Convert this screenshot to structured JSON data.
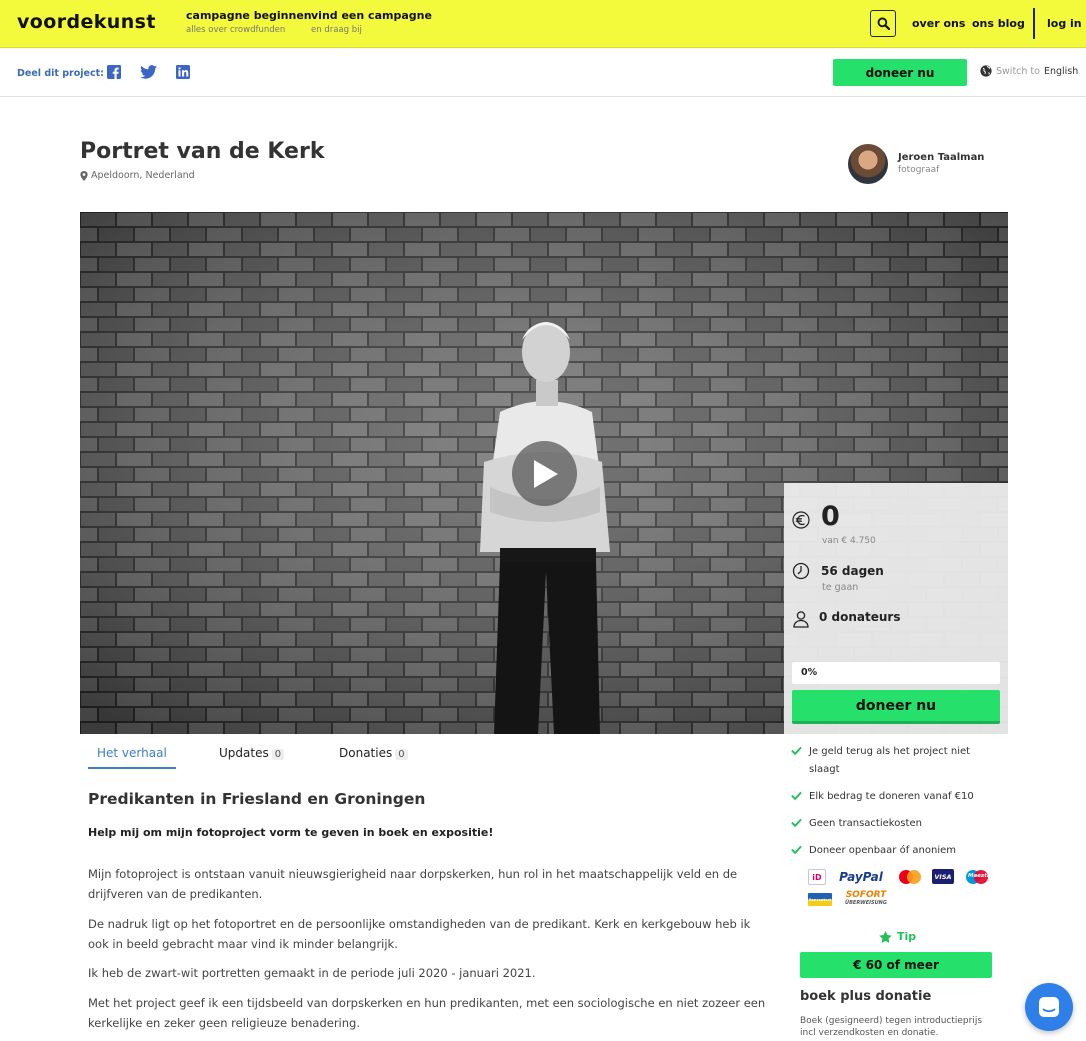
{
  "header": {
    "logo": "voordekunst",
    "nav": [
      {
        "title": "campagne beginnen",
        "sub": "alles over crowdfunden"
      },
      {
        "title": "vind een campagne",
        "sub": "en draag bij"
      }
    ],
    "links": {
      "about": "over ons",
      "blog": "ons blog",
      "login": "log in"
    }
  },
  "sharebar": {
    "label": "Deel dit project:",
    "donate_label": "doneer nu",
    "lang_prefix": "Switch to",
    "lang": "English"
  },
  "project": {
    "title": "Portret van de Kerk",
    "location": "Apeldoorn, Nederland",
    "author_name": "Jeroen Taalman",
    "author_role": "fotograaf"
  },
  "stats": {
    "amount": "0",
    "goal_text": "van € 4.750",
    "days": "56 dagen",
    "days_sub": "te gaan",
    "donors": "0 donateurs",
    "progress_label": "0%",
    "progress": 0,
    "donate_label": "doneer nu"
  },
  "tabs": [
    {
      "label": "Het verhaal",
      "count": ""
    },
    {
      "label": "Updates",
      "count": "0"
    },
    {
      "label": "Donaties",
      "count": "0"
    }
  ],
  "story": {
    "heading": "Predikanten in Friesland en Groningen",
    "lead": "Help mij om mijn fotoproject vorm te geven in boek en expositie!",
    "paragraphs": [
      "Mijn fotoproject is ontstaan vanuit nieuwsgierigheid naar dorpskerken, hun rol in het maatschappelijk veld en de drijfveren van de predikanten.",
      "De nadruk ligt op het fotoportret en de persoonlijke omstandigheden van de predikant. Kerk en kerkgebouw heb ik ook in beeld gebracht maar vind ik minder belangrijk.",
      "Ik heb de zwart-wit portretten gemaakt in de periode juli 2020 - januari 2021.",
      "Met het project geef ik een tijdsbeeld van dorpskerken en hun predikanten, met een sociologische en niet zozeer een kerkelijke en zeker geen religieuze benadering."
    ]
  },
  "benefits": [
    "Je geld terug als het project niet slaagt",
    "Elk bedrag te doneren vanaf €10",
    "Geen transactiekosten",
    "Doneer openbaar óf anoniem"
  ],
  "payments": {
    "paypal": "PayPal",
    "sofort": "SOFORT",
    "sofort_sub": "ÜBERWEISUNG",
    "visa": "VISA",
    "ideal": "iD",
    "maestro": "Maestro",
    "bancontact": "Bancontact"
  },
  "tip": {
    "label": "Tip",
    "amount": "€ 60 of meer",
    "reward_title": "boek plus donatie",
    "reward_desc": "Boek (gesigneerd) tegen introductieprijs incl verzendkosten en donatie."
  },
  "colors": {
    "brand_yellow": "#f3f93b",
    "accent_green": "#25e06b",
    "link_blue": "#3b7fc4"
  }
}
